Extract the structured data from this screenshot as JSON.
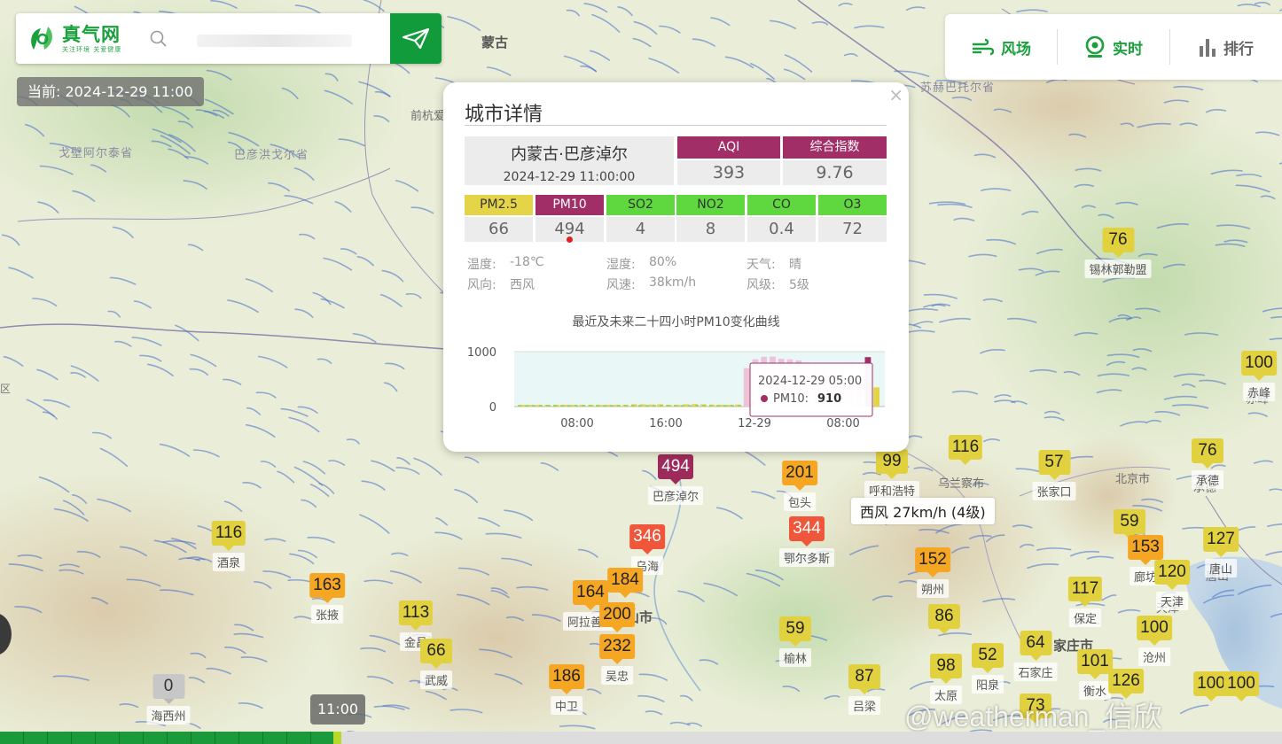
{
  "header": {
    "logo_name": "真气网",
    "logo_slogan": "关注环境 关爱健康",
    "current_time": "当前: 2024-12-29 11:00"
  },
  "nav": [
    {
      "label": "风场",
      "icon": "wind-icon"
    },
    {
      "label": "实时",
      "icon": "realtime-icon"
    },
    {
      "label": "排行",
      "icon": "ranking-icon"
    }
  ],
  "popup": {
    "title": "城市详情",
    "close": "×",
    "city": "内蒙古·巴彦淖尔",
    "time": "2024-12-29 11:00:00",
    "aqi_label": "AQI",
    "aqi": "393",
    "index_label": "综合指数",
    "index": "9.76",
    "pollutants": [
      {
        "name": "PM2.5",
        "value": "66",
        "color": "#e4d548"
      },
      {
        "name": "PM10",
        "value": "494",
        "color": "#a12e66"
      },
      {
        "name": "SO2",
        "value": "4",
        "color": "#5fd83f"
      },
      {
        "name": "NO2",
        "value": "8",
        "color": "#5fd83f"
      },
      {
        "name": "CO",
        "value": "0.4",
        "color": "#5fd83f"
      },
      {
        "name": "O3",
        "value": "72",
        "color": "#5fd83f"
      }
    ],
    "weather": {
      "temp_label": "温度:",
      "temp": "-18℃",
      "humidity_label": "湿度:",
      "humidity": "80%",
      "sky_label": "天气:",
      "sky": "晴",
      "wind_dir_label": "风向:",
      "wind_dir": "西风",
      "wind_speed_label": "风速:",
      "wind_speed": "38km/h",
      "wind_level_label": "风级:",
      "wind_level": "5级"
    },
    "chart_title": "最近及未来二十四小时PM10变化曲线",
    "tooltip_time": "2024-12-29 05:00",
    "tooltip_series": "PM10:",
    "tooltip_value": "910"
  },
  "chart_data": {
    "type": "bar",
    "title": "最近及未来二十四小时PM10变化曲线",
    "ylim": [
      0,
      1000
    ],
    "yticks": [
      "1000",
      "0"
    ],
    "xticks": [
      "08:00",
      "16:00",
      "12-29",
      "08:00"
    ],
    "series": [
      {
        "values": [
          10,
          10,
          10,
          10,
          10,
          10,
          10,
          10,
          10,
          10,
          10,
          10,
          30,
          40,
          40,
          35,
          40,
          30,
          30,
          40,
          45,
          40,
          35,
          30,
          30,
          35,
          700,
          860,
          905,
          910,
          870,
          860,
          840,
          800,
          760,
          740,
          700,
          760,
          650,
          650,
          900,
          350
        ],
        "colors": [
          "#e4d548"
        ]
      }
    ]
  },
  "wind_tip": "西风 27km/h (4级)",
  "timeline_badge": "11:00",
  "watermark": "@weatherman_信欣",
  "places": [
    {
      "name": "蒙古",
      "big": true
    },
    {
      "name": "前杭爱"
    },
    {
      "name": "戈壁阿尔泰省",
      "region": true
    },
    {
      "name": "巴彦洪戈尔省",
      "region": true
    },
    {
      "name": "苏赫巴托尔省",
      "region": true
    },
    {
      "name": "乌兰察布"
    },
    {
      "name": "北京市"
    },
    {
      "name": "山市",
      "big": true
    },
    {
      "name": "家庄市",
      "big": true
    },
    {
      "name": "天津"
    },
    {
      "name": "唐山"
    },
    {
      "name": "承德"
    },
    {
      "name": "赤峰"
    },
    {
      "name": "区"
    }
  ],
  "markers": [
    {
      "v": "76",
      "c": "c-green",
      "city": "锡林郭勒盟"
    },
    {
      "v": "100",
      "c": "c-green",
      "city": "赤峰"
    },
    {
      "v": "494",
      "c": "c-purple",
      "city": "巴彦淖尔"
    },
    {
      "v": "201",
      "c": "c-orange",
      "city": "包头"
    },
    {
      "v": "99",
      "c": "c-green",
      "city": "呼和浩特"
    },
    {
      "v": "116",
      "c": "c-green",
      "city": ""
    },
    {
      "v": "57",
      "c": "c-green",
      "city": "张家口"
    },
    {
      "v": "76",
      "c": "c-green",
      "city": "承德"
    },
    {
      "v": "344",
      "c": "c-red",
      "city": "鄂尔多斯"
    },
    {
      "v": "346",
      "c": "c-red",
      "city": "乌海"
    },
    {
      "v": "59",
      "c": "c-green",
      "city": ""
    },
    {
      "v": "153",
      "c": "c-orange",
      "city": "廊坊"
    },
    {
      "v": "127",
      "c": "c-green",
      "city": "唐山"
    },
    {
      "v": "120",
      "c": "c-green",
      "city": "天津"
    },
    {
      "v": "116",
      "c": "c-green",
      "city": "酒泉"
    },
    {
      "v": "163",
      "c": "c-orange",
      "city": "张掖"
    },
    {
      "v": "152",
      "c": "c-orange",
      "city": "朔州"
    },
    {
      "v": "117",
      "c": "c-green",
      "city": "保定"
    },
    {
      "v": "164",
      "c": "c-orange",
      "city": "阿拉善盟"
    },
    {
      "v": "184",
      "c": "c-orange",
      "city": ""
    },
    {
      "v": "200",
      "c": "c-orange",
      "city": ""
    },
    {
      "v": "113",
      "c": "c-green",
      "city": "金昌"
    },
    {
      "v": "66",
      "c": "c-green",
      "city": "武威"
    },
    {
      "v": "232",
      "c": "c-orange",
      "city": "吴忠"
    },
    {
      "v": "86",
      "c": "c-green",
      "city": ""
    },
    {
      "v": "59",
      "c": "c-green",
      "city": "榆林"
    },
    {
      "v": "100",
      "c": "c-green",
      "city": "沧州"
    },
    {
      "v": "98",
      "c": "c-green",
      "city": "太原"
    },
    {
      "v": "52",
      "c": "c-green",
      "city": "阳泉"
    },
    {
      "v": "64",
      "c": "c-green",
      "city": "石家庄"
    },
    {
      "v": "101",
      "c": "c-green",
      "city": "衡水"
    },
    {
      "v": "186",
      "c": "c-orange",
      "city": "中卫"
    },
    {
      "v": "87",
      "c": "c-green",
      "city": "吕梁"
    },
    {
      "v": "126",
      "c": "c-green",
      "city": ""
    },
    {
      "v": "0",
      "c": "c-gray",
      "city": "海西州"
    },
    {
      "v": "100",
      "c": "c-green",
      "city": ""
    },
    {
      "v": "100",
      "c": "c-green",
      "city": ""
    },
    {
      "v": "73",
      "c": "c-green",
      "city": ""
    }
  ]
}
